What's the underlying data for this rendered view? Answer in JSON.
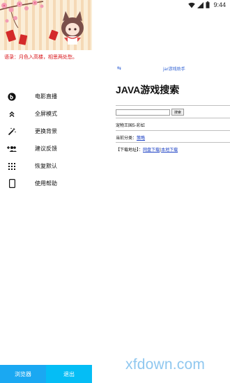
{
  "status_bar": {
    "time": "9:44"
  },
  "drawer": {
    "motto": "语录：月色入高楼，相思两处愁。",
    "menu": [
      {
        "label": "电影直播",
        "icon": "b-circle-icon"
      },
      {
        "label": "全屏模式",
        "icon": "chevron-up-double-icon"
      },
      {
        "label": "更换背景",
        "icon": "magic-wand-icon"
      },
      {
        "label": "建议反馈",
        "icon": "group-add-icon"
      },
      {
        "label": "恢复默认",
        "icon": "grid-dots-icon"
      },
      {
        "label": "使用帮助",
        "icon": "phone-icon"
      }
    ],
    "buttons": {
      "browser": "浏览器",
      "exit": "退出"
    }
  },
  "web": {
    "toolbar": {
      "back": "⇆",
      "title": "jar游戏助手"
    },
    "heading": "JAVA游戏搜索",
    "search_button": "搜索",
    "game_name": "宠物王国5-彩虹",
    "category_prefix": "当前分类：",
    "category_link": "策略",
    "download_prefix": "【下载地址】：",
    "download_cloud": "网盘下载",
    "download_sep": "|",
    "download_local": "本地下载"
  },
  "watermark": "xfdown.com",
  "colors": {
    "browser_button": "#1aa8f2",
    "exit_button": "#05bdf5",
    "motto_red": "#d8161b",
    "link_blue": "#1a3fc4"
  }
}
